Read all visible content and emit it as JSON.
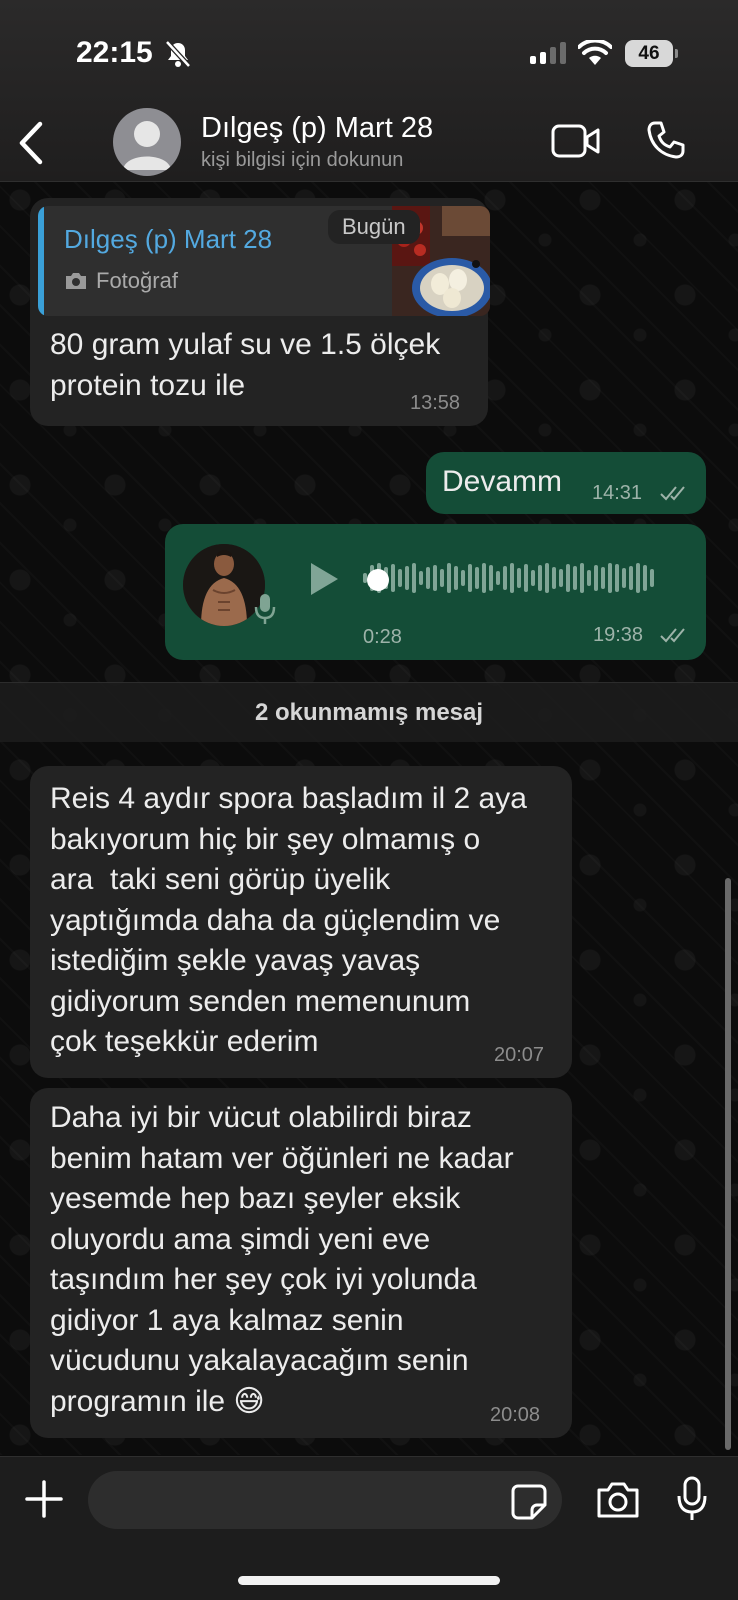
{
  "status_bar": {
    "time": "22:15",
    "battery": "46"
  },
  "header": {
    "contact_name": "Dılgeş (p) Mart 28",
    "subtitle": "kişi bilgisi için dokunun"
  },
  "messages": {
    "reply": {
      "quoted_name": "Dılgeş (p) Mart 28",
      "quoted_type": "Fotoğraf",
      "date_chip": "Bugün",
      "text_line1": "80 gram yulaf su ve 1.5 ölçek",
      "text_line2": "protein tozu ile",
      "time": "13:58"
    },
    "devamm": {
      "text": "Devamm",
      "time": "14:31"
    },
    "voice": {
      "duration": "0:28",
      "time": "19:38",
      "progress": 0
    },
    "unread_divider": "2 okunmamış mesaj",
    "msg1": {
      "lines": [
        "Reis 4 aydır spora başladım il 2 aya",
        "bakıyorum hiç bir şey olmamış o",
        "ara  taki seni görüp üyelik",
        "yaptığımda daha da güçlendim ve",
        "istediğim şekle yavaş yavaş",
        "gidiyorum senden memenunum",
        "çok teşekkür ederim"
      ],
      "time": "20:07"
    },
    "msg2": {
      "lines": [
        "Daha iyi bir vücut olabilirdi biraz",
        "benim hatam ver öğünleri ne kadar",
        "yesemde hep bazı şeyler eksik",
        "oluyordu ama şimdi yeni eve",
        "taşındım her şey çok iyi yolunda",
        "gidiyor 1 aya kalmaz senin",
        "vücudunu yakalayacağım senin",
        "programın ile"
      ],
      "emoji": "😅",
      "time": "20:08"
    }
  },
  "composer": {
    "placeholder": ""
  },
  "colors": {
    "incoming_bubble": "#232323",
    "outgoing_bubble": "#144d37",
    "quote_accent": "#53a9e0",
    "read_ticks": "#9db3a9"
  }
}
